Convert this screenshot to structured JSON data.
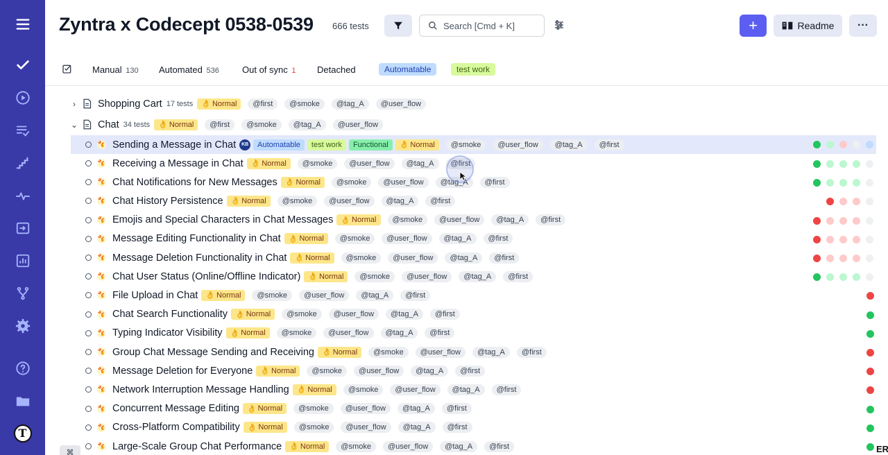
{
  "sidebar": {
    "icons": [
      "menu-icon",
      "checkmark-icon",
      "play-icon",
      "list-check-icon",
      "steps-icon",
      "pulse-icon",
      "import-icon",
      "bar-chart-icon",
      "branch-icon",
      "settings-icon",
      "help-icon",
      "folder-icon"
    ],
    "logo_letter": "T",
    "bg_color": "#3a39a8"
  },
  "header": {
    "title": "Zyntra x Codecept 0538-0539",
    "count": "666 tests",
    "search_placeholder": "Search [Cmd + K]",
    "add_label": "+",
    "readme_label": "Readme",
    "more_label": "···"
  },
  "tabs": {
    "manual": {
      "label": "Manual",
      "count": "130"
    },
    "automated": {
      "label": "Automated",
      "count": "536"
    },
    "out_of_sync": {
      "label": "Out of sync",
      "count": "1"
    },
    "detached": {
      "label": "Detached"
    },
    "automatable": {
      "label": "Automatable"
    },
    "test_work": {
      "label": "test work"
    }
  },
  "suites": [
    {
      "title": "Shopping Cart",
      "count": "17 tests",
      "priority": "Normal",
      "tags": [
        "@first",
        "@smoke",
        "@tag_A",
        "@user_flow"
      ],
      "expanded": false
    },
    {
      "title": "Chat",
      "count": "34 tests",
      "priority": "Normal",
      "tags": [
        "@first",
        "@smoke",
        "@tag_A",
        "@user_flow"
      ],
      "expanded": true
    }
  ],
  "selected_test": {
    "title": "Sending a Message in Chat",
    "avatar": "KB",
    "labels": [
      "Automatable",
      "test work",
      "Functional"
    ],
    "priority": "Normal",
    "tags": [
      "@smoke",
      "@user_flow",
      "@tag_A",
      "@first"
    ]
  },
  "tests": [
    {
      "title": "Receiving a Message in Chat",
      "priority": "Normal",
      "tags": [
        "@smoke",
        "@user_flow",
        "@tag_A",
        "@first"
      ]
    },
    {
      "title": "Chat Notifications for New Messages",
      "priority": "Normal",
      "tags": [
        "@smoke",
        "@user_flow",
        "@tag_A",
        "@first"
      ]
    },
    {
      "title": "Chat History Persistence",
      "priority": "Normal",
      "tags": [
        "@smoke",
        "@user_flow",
        "@tag_A",
        "@first"
      ]
    },
    {
      "title": "Emojis and Special Characters in Chat Messages",
      "priority": "Normal",
      "tags": [
        "@smoke",
        "@user_flow",
        "@tag_A",
        "@first"
      ]
    },
    {
      "title": "Message Editing Functionality in Chat",
      "priority": "Normal",
      "tags": [
        "@smoke",
        "@user_flow",
        "@tag_A",
        "@first"
      ]
    },
    {
      "title": "Message Deletion Functionality in Chat",
      "priority": "Normal",
      "tags": [
        "@smoke",
        "@user_flow",
        "@tag_A",
        "@first"
      ]
    },
    {
      "title": "Chat User Status (Online/Offline Indicator)",
      "priority": "Normal",
      "tags": [
        "@smoke",
        "@user_flow",
        "@tag_A",
        "@first"
      ]
    },
    {
      "title": "File Upload in Chat",
      "priority": "Normal",
      "tags": [
        "@smoke",
        "@user_flow",
        "@tag_A",
        "@first"
      ]
    },
    {
      "title": "Chat Search Functionality",
      "priority": "Normal",
      "tags": [
        "@smoke",
        "@user_flow",
        "@tag_A",
        "@first"
      ]
    },
    {
      "title": "Typing Indicator Visibility",
      "priority": "Normal",
      "tags": [
        "@smoke",
        "@user_flow",
        "@tag_A",
        "@first"
      ]
    },
    {
      "title": "Group Chat Message Sending and Receiving",
      "priority": "Normal",
      "tags": [
        "@smoke",
        "@user_flow",
        "@tag_A",
        "@first"
      ]
    },
    {
      "title": "Message Deletion for Everyone",
      "priority": "Normal",
      "tags": [
        "@smoke",
        "@user_flow",
        "@tag_A",
        "@first"
      ]
    },
    {
      "title": "Network Interruption Message Handling",
      "priority": "Normal",
      "tags": [
        "@smoke",
        "@user_flow",
        "@tag_A",
        "@first"
      ]
    },
    {
      "title": "Concurrent Message Editing",
      "priority": "Normal",
      "tags": [
        "@smoke",
        "@user_flow",
        "@tag_A",
        "@first"
      ]
    },
    {
      "title": "Cross-Platform Compatibility",
      "priority": "Normal",
      "tags": [
        "@smoke",
        "@user_flow",
        "@tag_A",
        "@first"
      ]
    },
    {
      "title": "Large-Scale Group Chat Performance",
      "priority": "Normal",
      "tags": [
        "@smoke",
        "@user_flow",
        "@tag_A",
        "@first"
      ]
    }
  ],
  "run_status": {
    "legend": {
      "g": "passed",
      "r": "failed",
      "gl": "passed-faded",
      "rl": "failed-faded",
      "e": "empty",
      "bl": "pending"
    },
    "selected": [
      "g",
      "gl",
      "rl",
      "e",
      "bl"
    ],
    "rows": [
      [
        "g",
        "gl",
        "gl",
        "gl",
        "e"
      ],
      [
        "g",
        "gl",
        "gl",
        "gl",
        "e"
      ],
      [
        "r",
        "rl",
        "rl",
        "e"
      ],
      [
        "r",
        "rl",
        "rl",
        "rl",
        "e"
      ],
      [
        "r",
        "rl",
        "rl",
        "rl",
        "e"
      ],
      [
        "r",
        "rl",
        "rl",
        "rl",
        "e"
      ],
      [
        "g",
        "gl",
        "gl",
        "gl",
        "e"
      ],
      [
        "r"
      ],
      [
        "g"
      ],
      [
        "g"
      ],
      [
        "r"
      ],
      [
        "r"
      ],
      [
        "r"
      ],
      [
        "g"
      ],
      [
        "g"
      ],
      [
        "g"
      ]
    ]
  },
  "footer": {
    "cmd_key": "⌘",
    "er_text": "ER"
  }
}
